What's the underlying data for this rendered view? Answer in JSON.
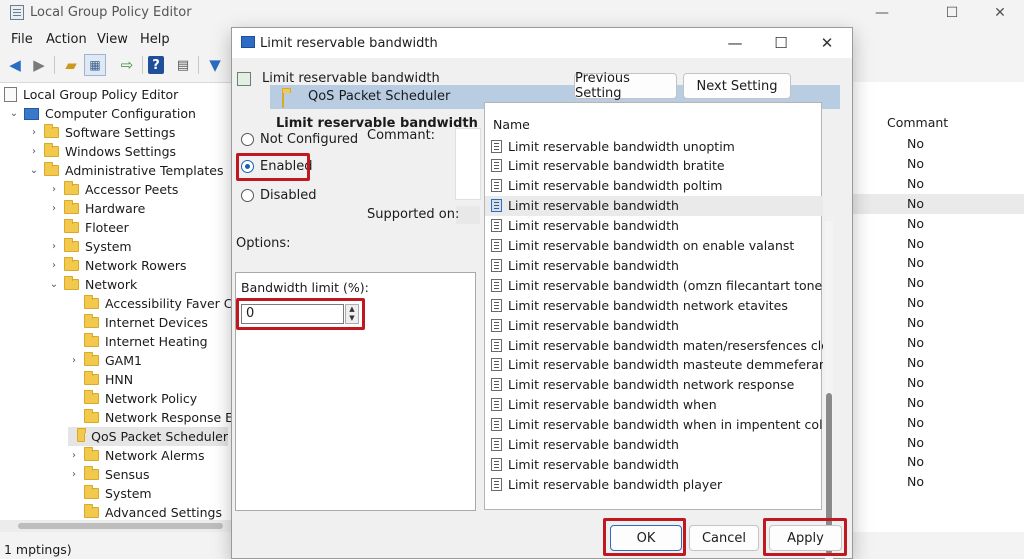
{
  "main_window": {
    "title": "Local Group Policy Editor",
    "controls": {
      "minimize": "—",
      "maximize": "☐",
      "close": "✕"
    }
  },
  "menu": [
    "File",
    "Action",
    "View",
    "Help"
  ],
  "toolbar_icons": [
    "back-arrow-icon",
    "forward-arrow-icon",
    "up-folder-icon",
    "show-hide-tree-icon",
    "export-list-icon",
    "help-icon",
    "properties-icon",
    "filter-icon"
  ],
  "tree": {
    "root": "Local Group Policy Editor",
    "computer": "Computer Configuration",
    "items": [
      "Software Settings",
      "Windows Settings",
      "Administrative Templates",
      "Accessor Peets",
      "Hardware",
      "Floteer",
      "System",
      "Network Rowers",
      "Network",
      "Accessibility Faver Conf",
      "Internet Devices",
      "Internet Heating",
      "GAM1",
      "HNN",
      "Network Policy",
      "Network Response Eox",
      "QoS Packet Scheduler",
      "Network Alerms",
      "Sensus",
      "System",
      "Advanced Settings"
    ],
    "selected": "QoS Packet Scheduler"
  },
  "status_text": "1 mptings)",
  "right_pane": {
    "column_header": "Commant",
    "values": [
      "No",
      "No",
      "No",
      "No",
      "No",
      "No",
      "No",
      "No",
      "No",
      "No",
      "No",
      "No",
      "No",
      "No",
      "No",
      "No",
      "No",
      "No"
    ]
  },
  "dialog": {
    "title": "Limit reservable bandwidth",
    "controls": {
      "minimize": "—",
      "maximize": "☐",
      "close": "✕"
    },
    "setting_name": "Limit reservable bandwidth",
    "category": "QoS Packet Scheduler",
    "header_bold": "Limit reservable bandwidth",
    "previous_button": "Previous Setting",
    "next_button": "Next Setting",
    "radios": {
      "not_configured": "Not Configured",
      "enabled": "Enabled",
      "disabled": "Disabled",
      "selected": "Enabled"
    },
    "comment_label": "Commant:",
    "supported_label": "Supported on:",
    "options_label": "Options:",
    "bandwidth_label": "Bandwidth limit (%):",
    "bandwidth_value": "0",
    "list_header": "Name",
    "list_items": [
      "Limit reservable bandwidth unoptim",
      "Limit reservable bandwidth bratite",
      "Limit reservable bandwidth poltim",
      "Limit reservable bandwidth",
      "Limit reservable bandwidth",
      "Limit reservable bandwidth on enable valanst",
      "Limit reservable bandwidth",
      "Limit reservable bandwidth (omzn filecantart toned)",
      "Limit reservable bandwidth network etavites",
      "Limit reservable bandwidth",
      "Limit reservable bandwidth maten/resersfences clostr...",
      "Limit reservable bandwidth masteute demmeferance",
      "Limit reservable bandwidth network response",
      "Limit reservable bandwidth when",
      "Limit reservable bandwidth when in impentent colitetio...",
      "Limit reservable bandwidth",
      "Limit reservable bandwidth",
      "Limit reservable bandwidth player"
    ],
    "selected_list_index": 3,
    "ok_button": "OK",
    "cancel_button": "Cancel",
    "apply_button": "Apply",
    "highlight_color": "#c0181f"
  }
}
